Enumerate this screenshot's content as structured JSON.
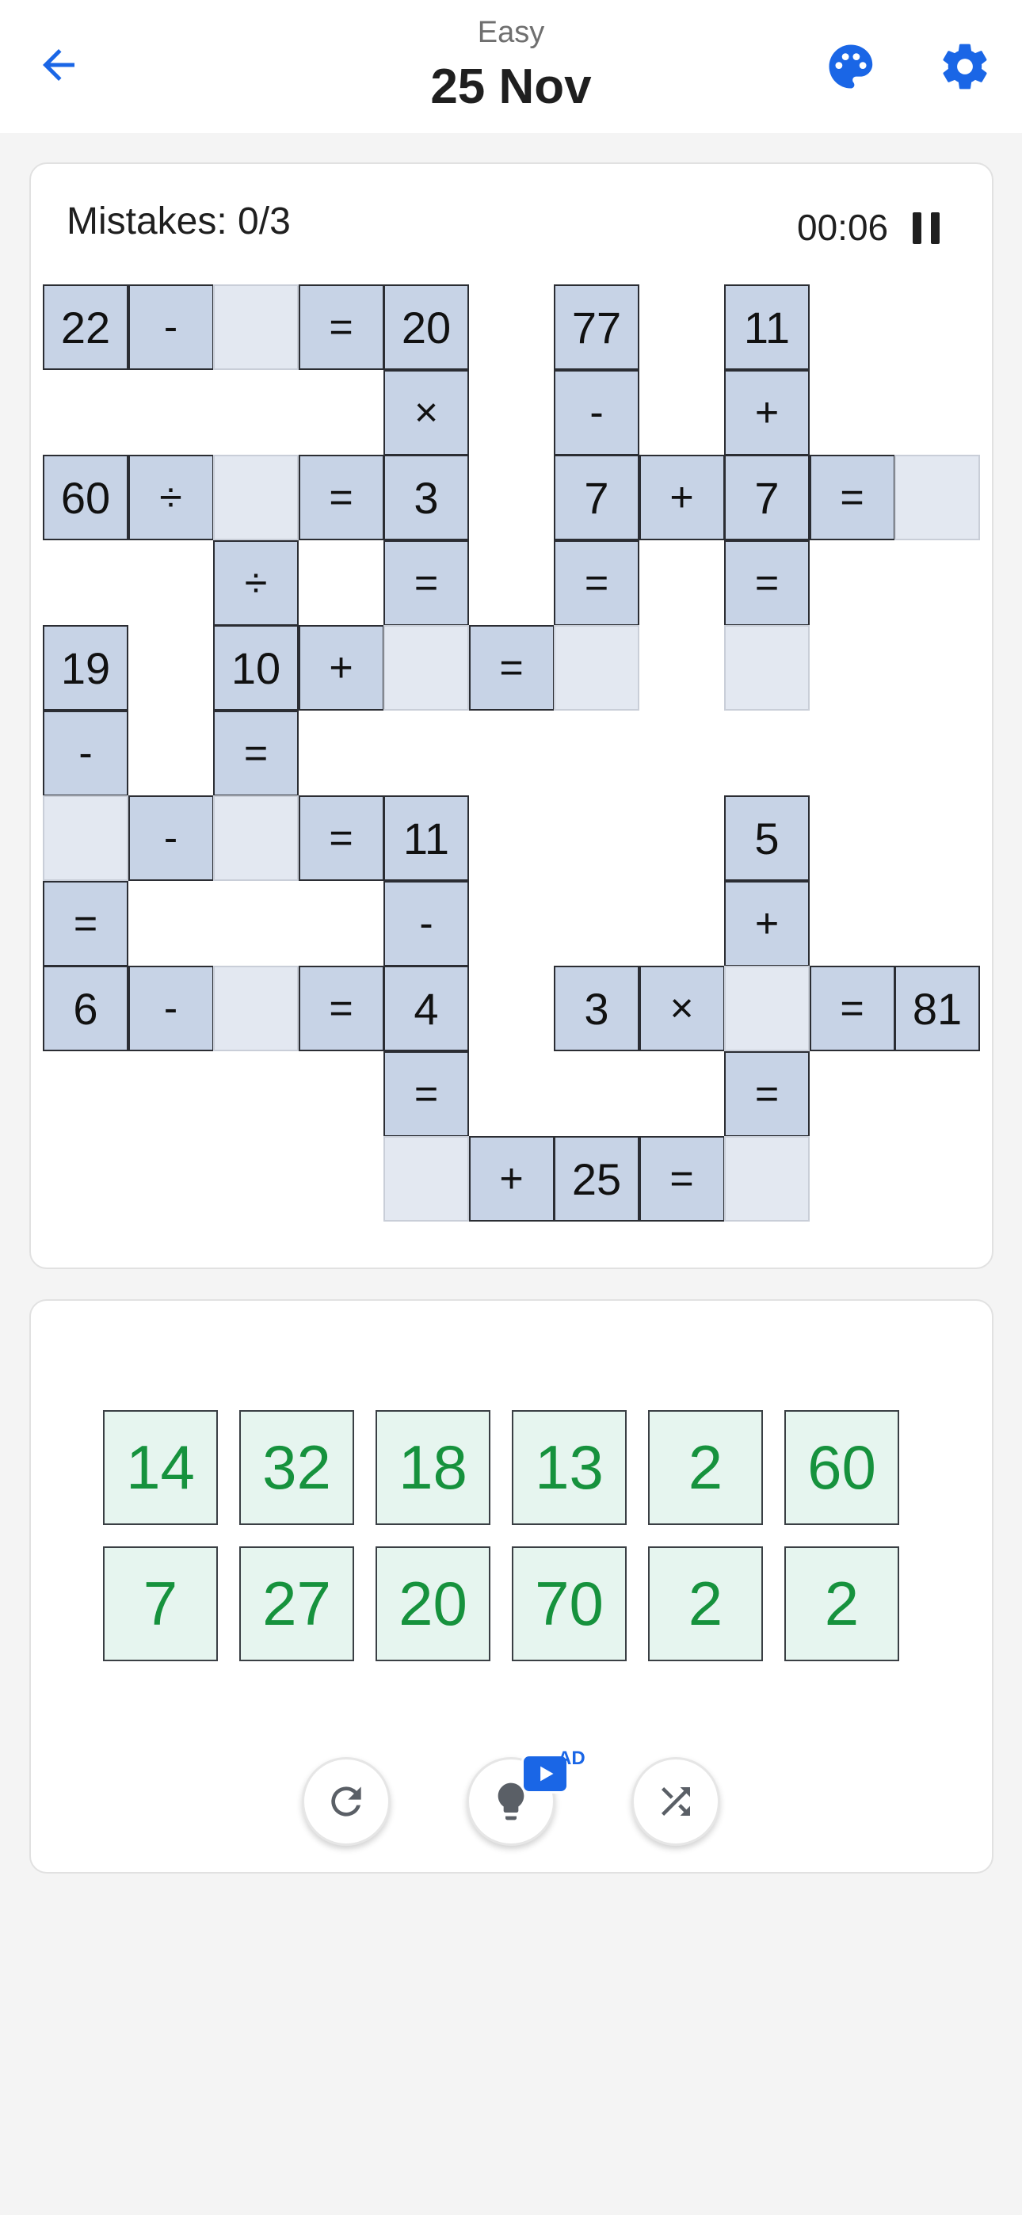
{
  "header": {
    "difficulty": "Easy",
    "date": "25 Nov",
    "accent_color": "#1a66e6"
  },
  "status": {
    "mistakes": "Mistakes: 0/3",
    "timer": "00:06"
  },
  "grid": {
    "rows": [
      [
        "22",
        "-",
        "_",
        "=",
        "20",
        "",
        "77",
        "",
        "11",
        "",
        "",
        ""
      ],
      [
        "",
        "",
        "",
        "",
        "×",
        "",
        "-",
        "",
        "+",
        "",
        "",
        ""
      ],
      [
        "60",
        "÷",
        "_",
        "=",
        "3",
        "",
        "7",
        "+",
        "7",
        "=",
        "_",
        ""
      ],
      [
        "",
        "",
        "÷",
        "",
        "=",
        "",
        "=",
        "",
        "=",
        "",
        "",
        ""
      ],
      [
        "19",
        "",
        "10",
        "+",
        "_",
        "=",
        "_",
        "",
        "_",
        "",
        "",
        ""
      ],
      [
        "-",
        "",
        "=",
        "",
        "",
        "",
        "",
        "",
        "",
        "",
        "",
        ""
      ],
      [
        "_",
        "-",
        "_",
        "=",
        "11",
        "",
        "",
        "",
        "5",
        "",
        "",
        ""
      ],
      [
        "=",
        "",
        "",
        "",
        "-",
        "",
        "",
        "",
        "+",
        "",
        "",
        ""
      ],
      [
        "6",
        "-",
        "_",
        "=",
        "4",
        "",
        "3",
        "×",
        "_",
        "=",
        "81",
        ""
      ],
      [
        "",
        "",
        "",
        "",
        "=",
        "",
        "",
        "",
        "=",
        "",
        "",
        ""
      ],
      [
        "",
        "",
        "",
        "",
        "_",
        "+",
        "25",
        "=",
        "_",
        "",
        "",
        ""
      ]
    ]
  },
  "tray": {
    "numbers": [
      "14",
      "32",
      "18",
      "13",
      "2",
      "60",
      "7",
      "27",
      "20",
      "70",
      "2",
      "2"
    ]
  },
  "actions": {
    "restart_icon": "restart-icon",
    "hint_icon": "lightbulb-icon",
    "ad_label": "AD",
    "shuffle_icon": "shuffle-icon"
  }
}
